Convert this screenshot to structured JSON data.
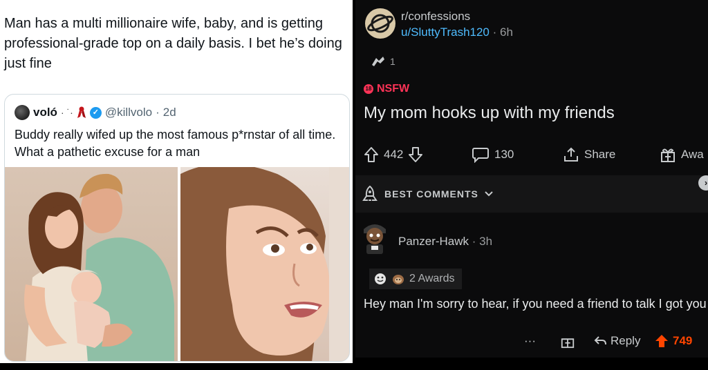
{
  "tweet": {
    "text": "Man has a multi millionaire wife, baby, and is getting professional-grade top on a daily basis. I bet he’s doing just fine",
    "quote": {
      "name": "voló",
      "dots": "· ˙·",
      "handle": "@killvolo",
      "time_sep": "·",
      "time": "2d",
      "text": "Buddy really wifed up the most famous p*rnstar of all time. What a pathetic excuse for a man"
    }
  },
  "reddit": {
    "subreddit": "r/confessions",
    "username": "u/SluttyTrash120",
    "time": "· 6h",
    "award_count": "1",
    "nsfw_label": "NSFW",
    "nsfw_badge": "18",
    "title": "My mom hooks up with my friends",
    "upvotes": "442",
    "comments": "130",
    "share_label": "Share",
    "award_label": "Awa",
    "best_comments_label": "BEST COMMENTS",
    "comment": {
      "user": "Panzer-Hawk",
      "time": "· 3h",
      "awards_label": "2 Awards",
      "body": "Hey man I'm sorry to hear, if you need a friend to talk I got you",
      "more": "···",
      "reply_label": "Reply",
      "votes": "749"
    }
  },
  "colors": {
    "reddit_orange": "#ff4500",
    "nsfw_red": "#ff3357",
    "link_blue": "#4fbcff",
    "twitter_blue": "#1d9bf0"
  }
}
